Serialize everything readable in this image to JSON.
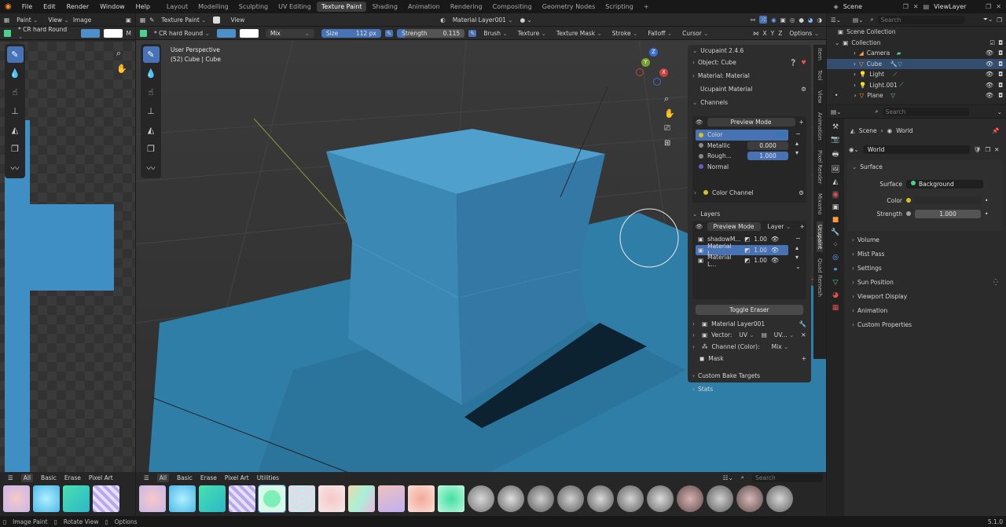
{
  "menubar": {
    "logo": "blender-logo",
    "items": [
      "File",
      "Edit",
      "Render",
      "Window",
      "Help"
    ],
    "workspaces": [
      "Layout",
      "Modelling",
      "Sculpting",
      "UV Editing",
      "Texture Paint",
      "Shading",
      "Animation",
      "Rendering",
      "Compositing",
      "Geometry Nodes",
      "Scripting"
    ],
    "active_workspace": "Texture Paint",
    "add": "+",
    "scene": "Scene",
    "view_layer": "ViewLayer"
  },
  "image_editor": {
    "mode": "Paint",
    "view": "View",
    "image": "Image",
    "brush": "* CR hard Round",
    "more": "M",
    "bottom_tabs": [
      "All",
      "Basic",
      "Erase",
      "Pixel Art"
    ]
  },
  "viewport": {
    "mode": "Texture Paint",
    "view": "View",
    "brush": "* CR hard Round",
    "blend": "Mix",
    "size_label": "Size",
    "size_value": "112 px",
    "strength_label": "Strength",
    "strength_value": "0.115",
    "menus": [
      "Brush",
      "Texture",
      "Texture Mask",
      "Stroke",
      "Falloff",
      "Cursor"
    ],
    "axes": [
      "X",
      "Y",
      "Z"
    ],
    "options": "Options",
    "material_slot": "Material Layer001",
    "info_line1": "User Perspective",
    "info_line2": "(52) Cube | Cube",
    "gizmo": {
      "x": "X",
      "y": "Y",
      "z": "Z"
    },
    "bottom_tabs": [
      "All",
      "Basic",
      "Erase",
      "Pixel Art",
      "Utilities"
    ],
    "search_placeholder": "Search"
  },
  "ucupaint": {
    "title": "Ucupaint 2.4.6",
    "object": "Object: Cube",
    "material": "Material: Material",
    "ucupaint_material": "Ucupaint Material",
    "channels_title": "Channels",
    "preview_mode": "Preview Mode",
    "channels": [
      {
        "name": "Color",
        "value": "",
        "dot": "#d8c020"
      },
      {
        "name": "Metallic",
        "value": "0.000",
        "dot": "#888888"
      },
      {
        "name": "Rough...",
        "value": "1.000",
        "dot": "#888888"
      },
      {
        "name": "Normal",
        "value": "",
        "dot": "#6a5acd"
      }
    ],
    "color_channel": "Color Channel",
    "layers_title": "Layers",
    "layer_dropdown": "Layer",
    "layers": [
      {
        "name": "shadowM...",
        "value": "1.00"
      },
      {
        "name": "Material L...",
        "value": "1.00"
      },
      {
        "name": "Material L...",
        "value": "1.00"
      }
    ],
    "toggle_eraser": "Toggle Eraser",
    "layer_name": "Material Layer001",
    "vector_label": "Vector:",
    "vector_uv": "UV",
    "vector_map": "UV...",
    "channel_label": "Channel (Color):",
    "channel_blend": "Mix",
    "mask": "Mask",
    "custom_bake": "Custom Bake Targets",
    "stats": "Stats"
  },
  "side_tabs": [
    "Item",
    "Tool",
    "View",
    "Animation",
    "Pixel Render",
    "Mixamo",
    "Ucupaint",
    "Quad Remesh"
  ],
  "outliner": {
    "search_placeholder": "Search",
    "root": "Scene Collection",
    "collection": "Collection",
    "items": [
      "Camera",
      "Cube",
      "Light",
      "Light.001",
      "Plane"
    ],
    "selected": "Cube"
  },
  "properties": {
    "search_placeholder": "Search",
    "breadcrumb_scene": "Scene",
    "breadcrumb_world": "World",
    "world_name": "World",
    "surface": "Surface",
    "surface_label": "Surface",
    "surface_value": "Background",
    "color_label": "Color",
    "strength_label": "Strength",
    "strength_value": "1.000",
    "sections": [
      "Volume",
      "Mist Pass",
      "Settings",
      "Sun Position",
      "Viewport Display",
      "Animation",
      "Custom Properties"
    ]
  },
  "statusbar": {
    "item1": "Image Paint",
    "item2": "Rotate View",
    "item3": "Options",
    "version": "5.1.0"
  }
}
